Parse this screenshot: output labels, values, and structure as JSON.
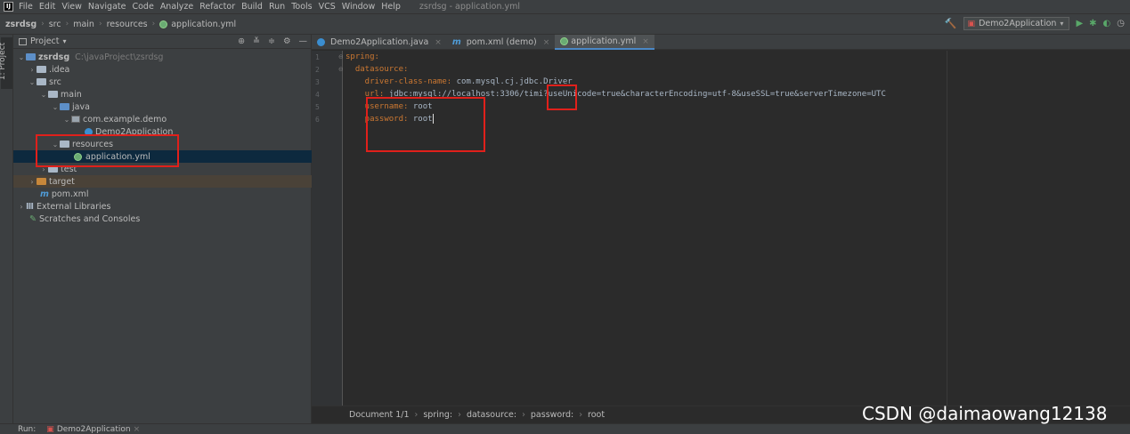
{
  "menubar": {
    "logo": "IJ",
    "items": [
      "File",
      "Edit",
      "View",
      "Navigate",
      "Code",
      "Analyze",
      "Refactor",
      "Build",
      "Run",
      "Tools",
      "VCS",
      "Window",
      "Help"
    ],
    "window_title": "zsrdsg - application.yml"
  },
  "navbar": {
    "crumbs": [
      "zsrdsg",
      "src",
      "main",
      "resources",
      "application.yml"
    ],
    "run_config": "Demo2Application"
  },
  "left_strip": {
    "project_tab": "1: Project"
  },
  "project_panel": {
    "title": "Project",
    "tree": [
      {
        "label": "zsrdsg",
        "extra": "C:\\javaProject\\zsrdsg"
      },
      {
        "label": ".idea"
      },
      {
        "label": "src"
      },
      {
        "label": "main"
      },
      {
        "label": "java"
      },
      {
        "label": "com.example.demo"
      },
      {
        "label": "Demo2Application"
      },
      {
        "label": "resources"
      },
      {
        "label": "application.yml"
      },
      {
        "label": "test"
      },
      {
        "label": "target"
      },
      {
        "label": "pom.xml"
      },
      {
        "label": "External Libraries"
      },
      {
        "label": "Scratches and Consoles"
      }
    ]
  },
  "editor": {
    "tabs": [
      "Demo2Application.java",
      "pom.xml (demo)",
      "application.yml"
    ],
    "line_numbers": [
      "1",
      "2",
      "3",
      "4",
      "5",
      "6"
    ],
    "lines": [
      {
        "key": "spring:",
        "val": ""
      },
      {
        "key": "  datasource:",
        "val": ""
      },
      {
        "key": "    driver-class-name:",
        "val": " com.mysql.cj.jdbc.Driver"
      },
      {
        "key": "    url:",
        "val": " jdbc:mysql://localhost:3306/timi?useUnicode=true&characterEncoding=utf-8&useSSL=true&serverTimezone=UTC"
      },
      {
        "key": "    username:",
        "val": " root"
      },
      {
        "key": "    password:",
        "val": " root"
      }
    ],
    "breadcrumbs": [
      "Document 1/1",
      "spring:",
      "datasource:",
      "password:",
      "root"
    ]
  },
  "runbar": {
    "label": "Run:",
    "config": "Demo2Application"
  },
  "watermark": "CSDN @daimaowang12138"
}
